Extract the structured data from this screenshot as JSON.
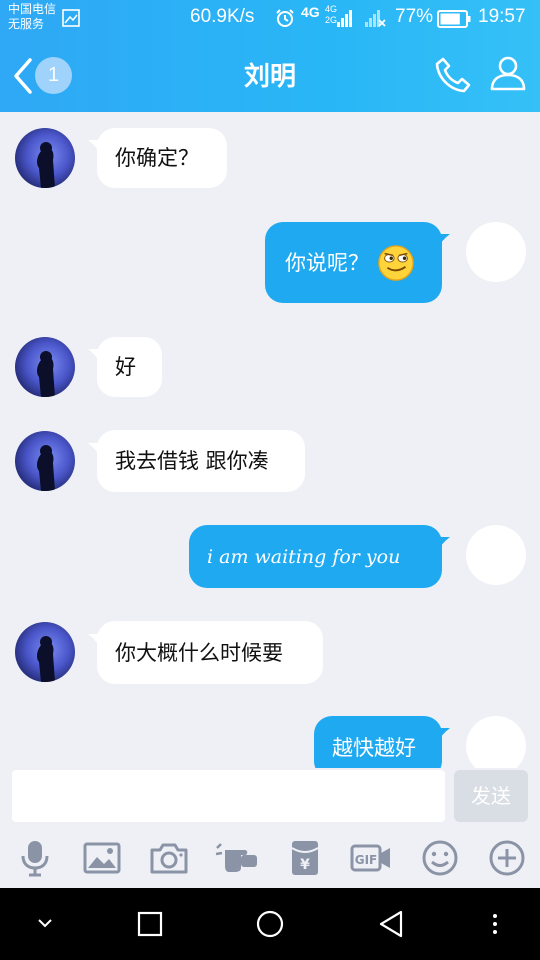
{
  "status_bar": {
    "carrier_line1": "中国电信",
    "carrier_line2": "无服务",
    "net_speed": "60.9K/s",
    "net_type_top": "4G",
    "net_type_sub_top": "4G",
    "net_type_sub_bottom": "2G",
    "battery_percent": "77%",
    "battery_level": 0.77,
    "time": "19:57"
  },
  "header": {
    "unread_count": "1",
    "contact_name": "刘明"
  },
  "messages": [
    {
      "side": "left",
      "text": "你确定？"
    },
    {
      "side": "right",
      "text": "你说呢？",
      "emoji": "smirk-emoji"
    },
    {
      "side": "left",
      "text": "好"
    },
    {
      "side": "left",
      "text": "我去借钱 跟你凑"
    },
    {
      "side": "right",
      "text": "i am waiting for you"
    },
    {
      "side": "left",
      "text": "你大概什么时候要"
    },
    {
      "side": "right",
      "text": "越快越好"
    }
  ],
  "composer": {
    "input_value": "",
    "send_label": "发送"
  },
  "toolbar_icons": [
    "microphone-icon",
    "image-icon",
    "camera-icon",
    "poke-hand-icon",
    "red-packet-icon",
    "gif-icon",
    "emoji-icon",
    "plus-icon"
  ],
  "colors": {
    "header": "#29b6f6",
    "bubble_sent": "#1fa9f1",
    "bubble_received": "#ffffff",
    "chat_bg": "#eff0f5"
  }
}
